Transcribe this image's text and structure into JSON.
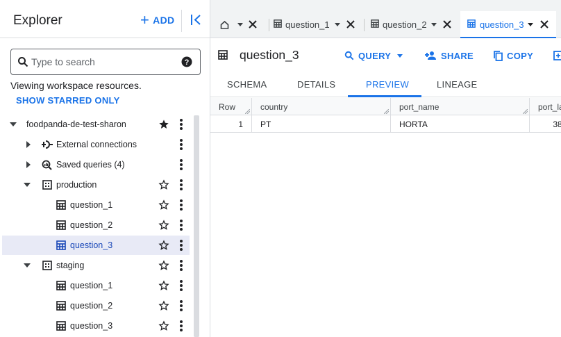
{
  "explorer": {
    "title": "Explorer",
    "add_label": "ADD",
    "search_placeholder": "Type to search",
    "viewing_text": "Viewing workspace resources.",
    "show_starred_label": "SHOW STARRED ONLY"
  },
  "tree": {
    "project": {
      "label": "foodpanda-de-test-sharon",
      "starred": true
    },
    "external_connections": {
      "label": "External connections"
    },
    "saved_queries": {
      "label": "Saved queries (4)"
    },
    "production": {
      "label": "production",
      "tables": [
        {
          "label": "question_1",
          "selected": false
        },
        {
          "label": "question_2",
          "selected": false
        },
        {
          "label": "question_3",
          "selected": true
        }
      ]
    },
    "staging": {
      "label": "staging",
      "tables": [
        {
          "label": "question_1"
        },
        {
          "label": "question_2"
        },
        {
          "label": "question_3"
        }
      ]
    }
  },
  "tabs": {
    "home_icon": "home-icon",
    "items": [
      {
        "label": "question_1",
        "active": false
      },
      {
        "label": "question_2",
        "active": false
      },
      {
        "label": "question_3",
        "active": true
      }
    ]
  },
  "toolbar": {
    "title": "question_3",
    "query_label": "QUERY",
    "share_label": "SHARE",
    "copy_label": "COPY"
  },
  "subtabs": {
    "items": [
      "SCHEMA",
      "DETAILS",
      "PREVIEW",
      "LINEAGE"
    ],
    "active": "PREVIEW"
  },
  "preview": {
    "columns": [
      "Row",
      "country",
      "port_name",
      "port_la"
    ],
    "rows": [
      [
        "1",
        "PT",
        "HORTA",
        "38."
      ]
    ]
  },
  "colors": {
    "accent": "#1a73e8",
    "selected_row_bg": "#e8eaf6",
    "tabbar_bg": "#f1f3f4"
  }
}
